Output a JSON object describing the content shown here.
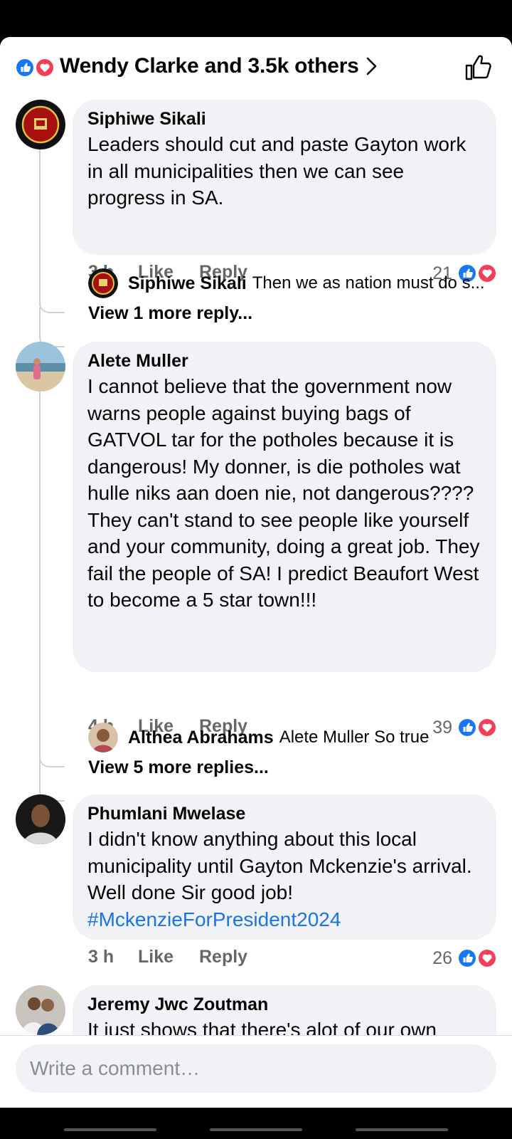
{
  "header": {
    "title": "Wendy Clarke and 3.5k others",
    "reaction_icons": [
      "like-icon",
      "love-icon"
    ],
    "like_color": "#1877f2",
    "love_color": "#f33e58"
  },
  "comments": [
    {
      "author": "Siphiwe Sikali",
      "text": "Leaders should cut and paste Gayton work in all municipalities then we can see progress in SA.",
      "time": "3 h",
      "like_label": "Like",
      "reply_label": "Reply",
      "reaction_count": "21",
      "avatar_text": "VINYL SINCE 1978",
      "reply_preview": {
        "author": "Siphiwe Sikali",
        "text": "Then we as nation must do s..."
      },
      "more_replies": "View 1 more reply..."
    },
    {
      "author": "Alete Muller",
      "text_lines": [
        "I cannot believe that the government now warns people against buying bags of GATVOL tar for the potholes because it is dangerous! My donner, is die potholes wat hulle niks aan doen nie, not dangerous????",
        "They can't stand to see people like yourself and your community, doing a great job. They fail the people of SA! I predict Beaufort West to become a 5 star town!!!"
      ],
      "time": "4 h",
      "like_label": "Like",
      "reply_label": "Reply",
      "reaction_count": "39",
      "reply_preview": {
        "author": "Althea Abrahams",
        "text": "Alete Muller So true"
      },
      "more_replies": "View 5 more replies..."
    },
    {
      "author": "Phumlani Mwelase",
      "text": "I didn't know anything about this local municipality until Gayton Mckenzie's arrival. Well done Sir good job!",
      "hashtag": "#MckenzieForPresident2024",
      "time": "3 h",
      "like_label": "Like",
      "reply_label": "Reply",
      "reaction_count": "26"
    },
    {
      "author": "Jeremy Jwc Zoutman",
      "text": "It just shows that there's alot of our own"
    }
  ],
  "composer": {
    "placeholder": "Write a comment…"
  }
}
